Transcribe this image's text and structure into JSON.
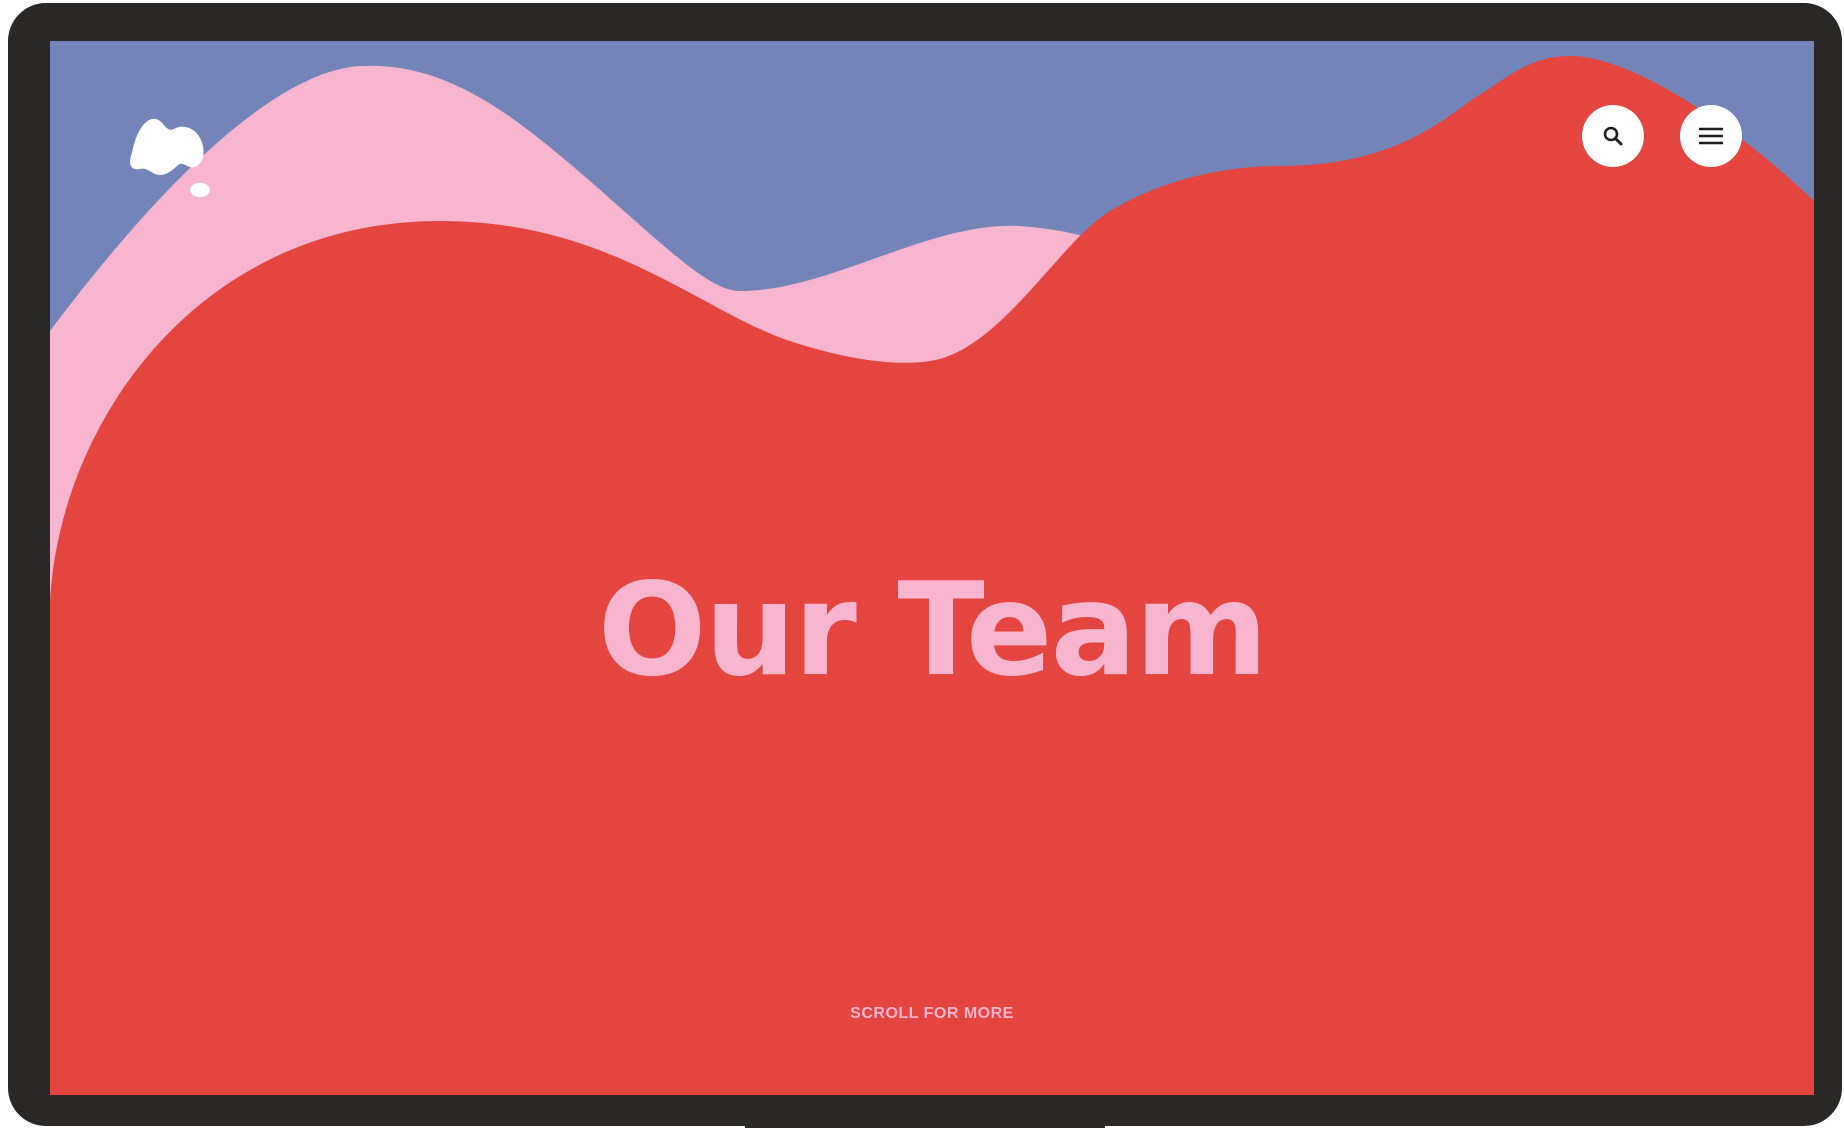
{
  "colors": {
    "frame": "#2a2826",
    "sky": "#7385b8",
    "pink": "#f7b5cf",
    "red": "#e5453f",
    "white": "#ffffff",
    "icon_stroke": "#1e1e1e"
  },
  "brand": {
    "logo_icon": "blob-cloud-logo-icon"
  },
  "header": {
    "search_icon": "search-icon",
    "menu_icon": "hamburger-menu-icon"
  },
  "hero": {
    "title": "Our Team"
  },
  "footer": {
    "scroll_label": "SCROLL FOR MORE"
  }
}
